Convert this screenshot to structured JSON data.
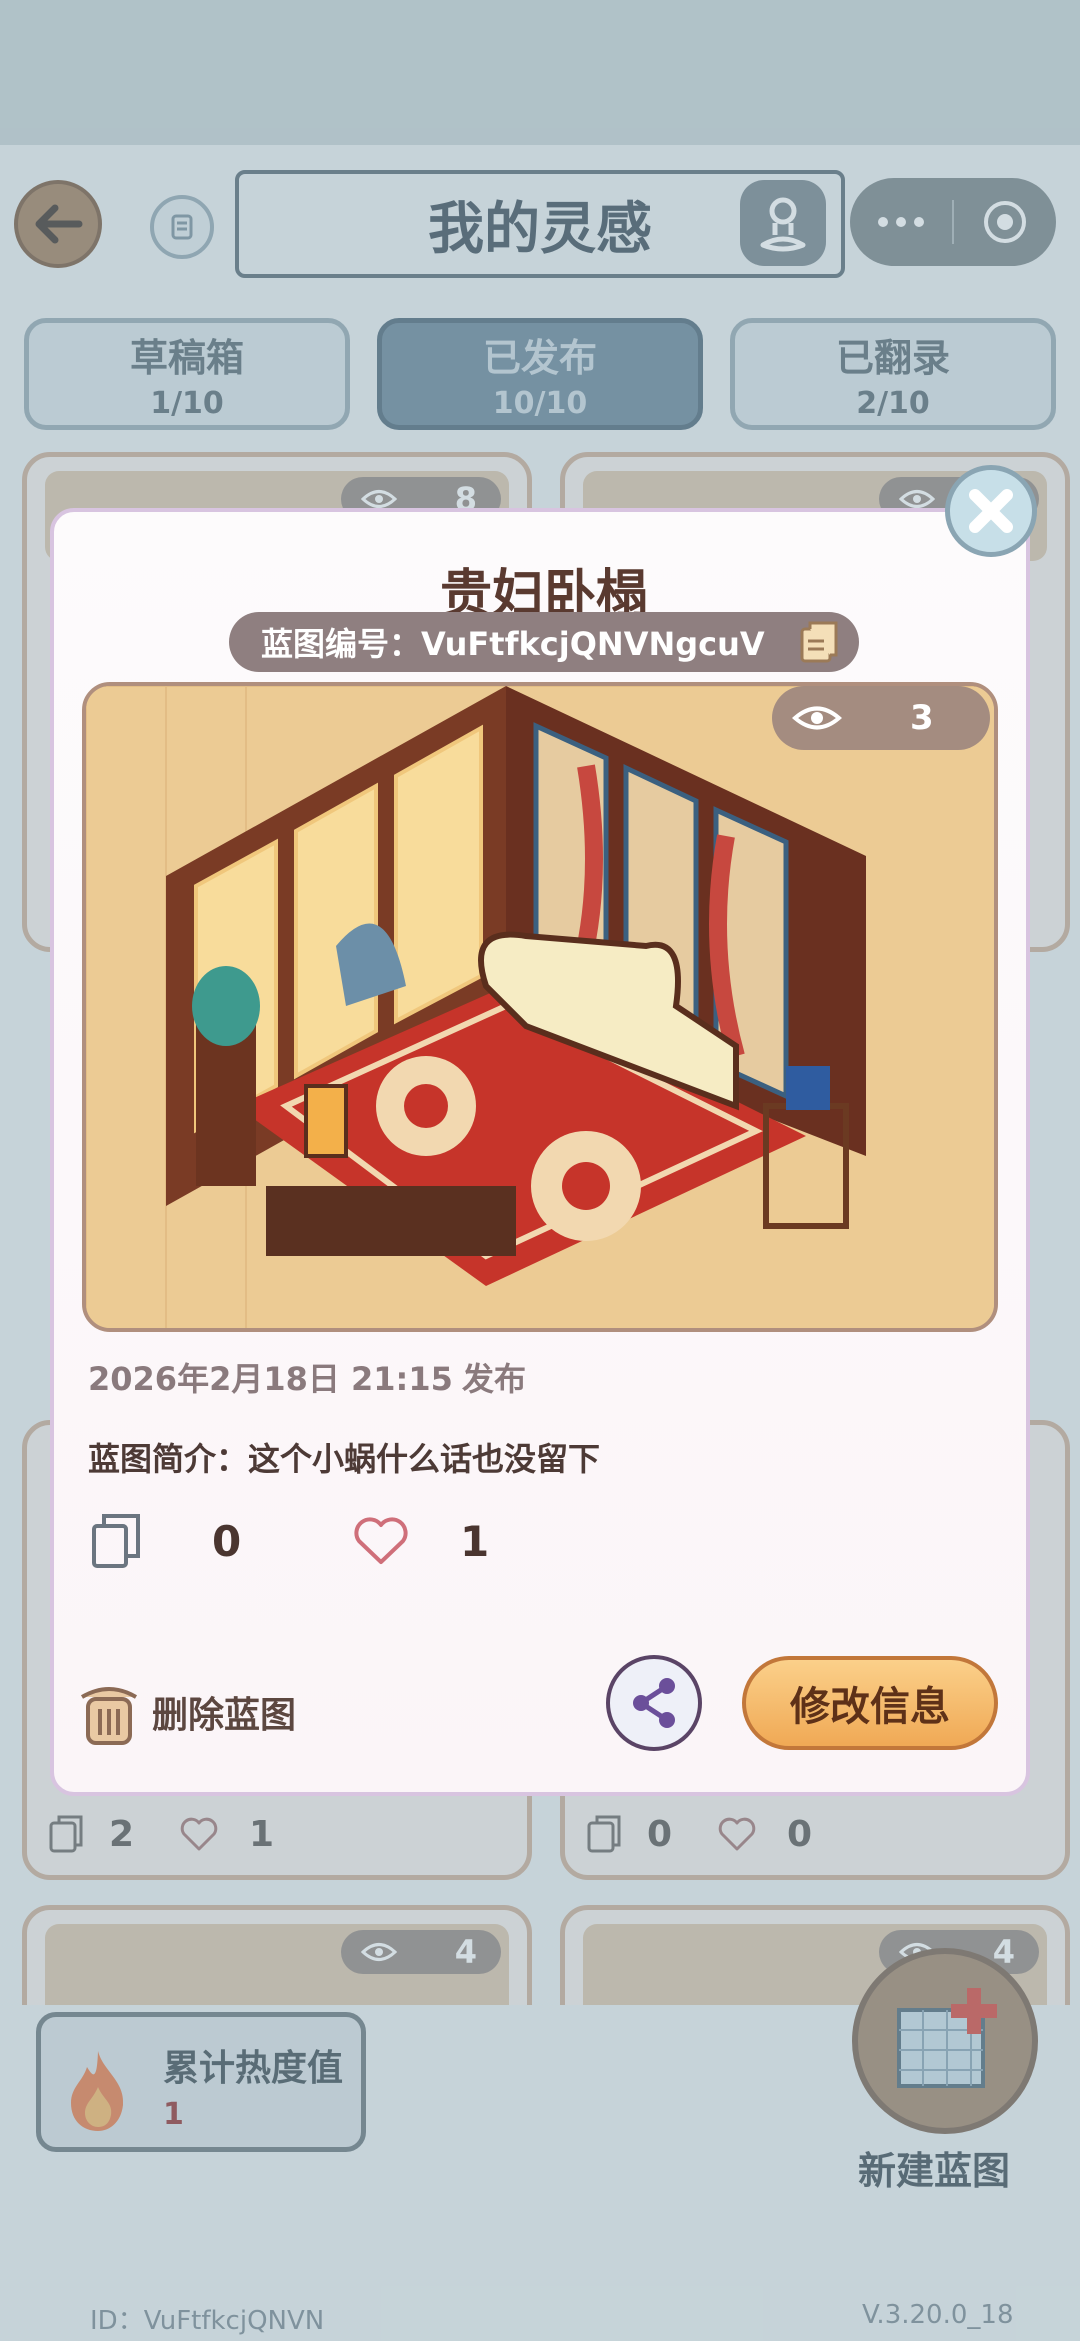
{
  "header": {
    "title": "我的灵感",
    "back_icon": "back-arrow-icon",
    "scroll_icon": "scroll-icon",
    "person_icon": "person-pin-icon",
    "more_icon": "more-dots-icon",
    "target_icon": "record-target-icon"
  },
  "tabs": [
    {
      "label": "草稿箱",
      "count": "1/10"
    },
    {
      "label": "已发布",
      "count": "10/10"
    },
    {
      "label": "已翻录",
      "count": "2/10"
    }
  ],
  "background_cards": [
    {
      "views": "8"
    },
    {
      "views": ""
    },
    {
      "views": "4"
    },
    {
      "views": "4"
    }
  ],
  "background_stats": [
    {
      "copies": "2",
      "likes": "1"
    },
    {
      "copies": "0",
      "likes": "0"
    }
  ],
  "heat": {
    "label": "累计热度值",
    "value": "1"
  },
  "new_blueprint": {
    "label": "新建蓝图"
  },
  "footer": {
    "user_id": "ID：VuFtfkcjQNVN",
    "version": "V.3.20.0_18"
  },
  "modal": {
    "title": "贵妇卧榻",
    "code": "蓝图编号：VuFtfkcjQNVNgcuV",
    "views": "3",
    "date": "2026年2月18日 21:15",
    "status": "发布",
    "description": "蓝图简介：这个小蜗什么话也没留下",
    "copies": "0",
    "likes": "1",
    "delete_label": "删除蓝图",
    "edit_label": "修改信息"
  },
  "colors": {
    "accent_orange": "#f0a955",
    "active_tab": "#5e7c92",
    "modal_title": "#5a3a30"
  }
}
